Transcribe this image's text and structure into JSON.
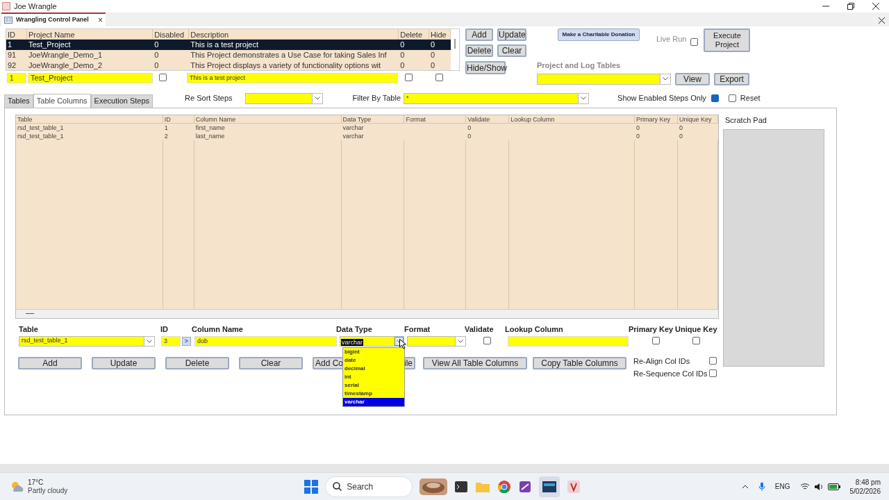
{
  "window": {
    "title": "Joe Wrangle"
  },
  "document_tab": {
    "label": "Wrangling Control Panel",
    "close": "×"
  },
  "projects": {
    "columns": [
      "ID",
      "Project Name",
      "Disabled",
      "Description",
      "Delete",
      "Hide"
    ],
    "rows": [
      {
        "cells": [
          "1",
          "Test_Project",
          "0",
          "This is a test project",
          "0",
          "0"
        ],
        "selected": true
      },
      {
        "cells": [
          "91",
          "JoeWrangle_Demo_1",
          "0",
          "This Project demonstrates a Use Case for taking Sales Inf",
          "0",
          "0"
        ],
        "selected": false
      },
      {
        "cells": [
          "92",
          "JoeWrangle_Demo_2",
          "0",
          "This Project displays a  variety of functionality options wit",
          "0",
          "0"
        ],
        "selected": false
      }
    ]
  },
  "project_form": {
    "id": "1",
    "name": "Test_Project",
    "disabled": false,
    "description": "This is a test project",
    "delete": false,
    "hide": false
  },
  "project_buttons": [
    "Add",
    "Update",
    "Delete",
    "Clear",
    "Hide/Show"
  ],
  "donation_button": "Make a Charitable Donation",
  "live_run": {
    "label": "Live Run",
    "checked": false
  },
  "execute_button": "Execute Project",
  "project_log_tables": {
    "label": "Project and Log Tables",
    "buttons": [
      "View",
      "Export"
    ]
  },
  "form_tabs": [
    {
      "label": "Tables",
      "selected": false
    },
    {
      "label": "Table Columns",
      "selected": true
    },
    {
      "label": "Execution Steps",
      "selected": false
    }
  ],
  "re_sort_steps": {
    "label": "Re Sort Steps"
  },
  "filter_by_table": {
    "label": "Filter By Table",
    "value": "*"
  },
  "show_enabled_steps_only": {
    "label": "Show Enabled Steps Only",
    "checked": true
  },
  "reset": {
    "label": "Reset",
    "checked": false
  },
  "columns_table": {
    "columns": [
      "Table",
      "ID",
      "Column Name",
      "Data Type",
      "Format",
      "Validate",
      "Lookup Column",
      "Primary Key",
      "Unique Key"
    ],
    "rows": [
      [
        "rsd_test_table_1",
        "1",
        "first_name",
        "varchar",
        "",
        "0",
        "",
        "0",
        "0"
      ],
      [
        "rsd_test_table_1",
        "2",
        "last_name",
        "varchar",
        "",
        "0",
        "",
        "0",
        "0"
      ]
    ]
  },
  "scratch_pad": {
    "label": "Scratch Pad"
  },
  "column_form": {
    "table_label": "Table",
    "table": "rsd_test_table_1",
    "id_label": "ID",
    "id": "3",
    "next": ">",
    "name_label": "Column Name",
    "name": "dob",
    "type_label": "Data Type",
    "type": "varchar",
    "format_label": "Format",
    "validate_label": "Validate",
    "validate": false,
    "lookup_label": "Lookup Column",
    "primary_label": "Primary Key",
    "primary": false,
    "unique_label": "Unique Key",
    "unique": false
  },
  "data_type_dropdown": [
    {
      "label": "bigint",
      "selected": false
    },
    {
      "label": "date",
      "selected": false
    },
    {
      "label": "decimal",
      "selected": false
    },
    {
      "label": "int",
      "selected": false
    },
    {
      "label": "serial",
      "selected": false
    },
    {
      "label": "timestamp",
      "selected": false
    },
    {
      "label": "varchar",
      "selected": true
    }
  ],
  "column_buttons": [
    "Add",
    "Update",
    "Delete",
    "Clear"
  ],
  "add_column_button": {
    "start": "Add Co",
    "end": "ile"
  },
  "column_buttons_right": [
    "View All Table Columns",
    "Copy Table Columns"
  ],
  "col_options": [
    {
      "label": "Re-Align Col IDs",
      "checked": false
    },
    {
      "label": "Re-Sequence Col IDs",
      "checked": false
    }
  ],
  "taskbar": {
    "temperature": "17°C",
    "weather": "Partly cloudy",
    "search": "Search",
    "language": "ENG",
    "time": "8:48 pm",
    "date": "5/02/2026"
  }
}
